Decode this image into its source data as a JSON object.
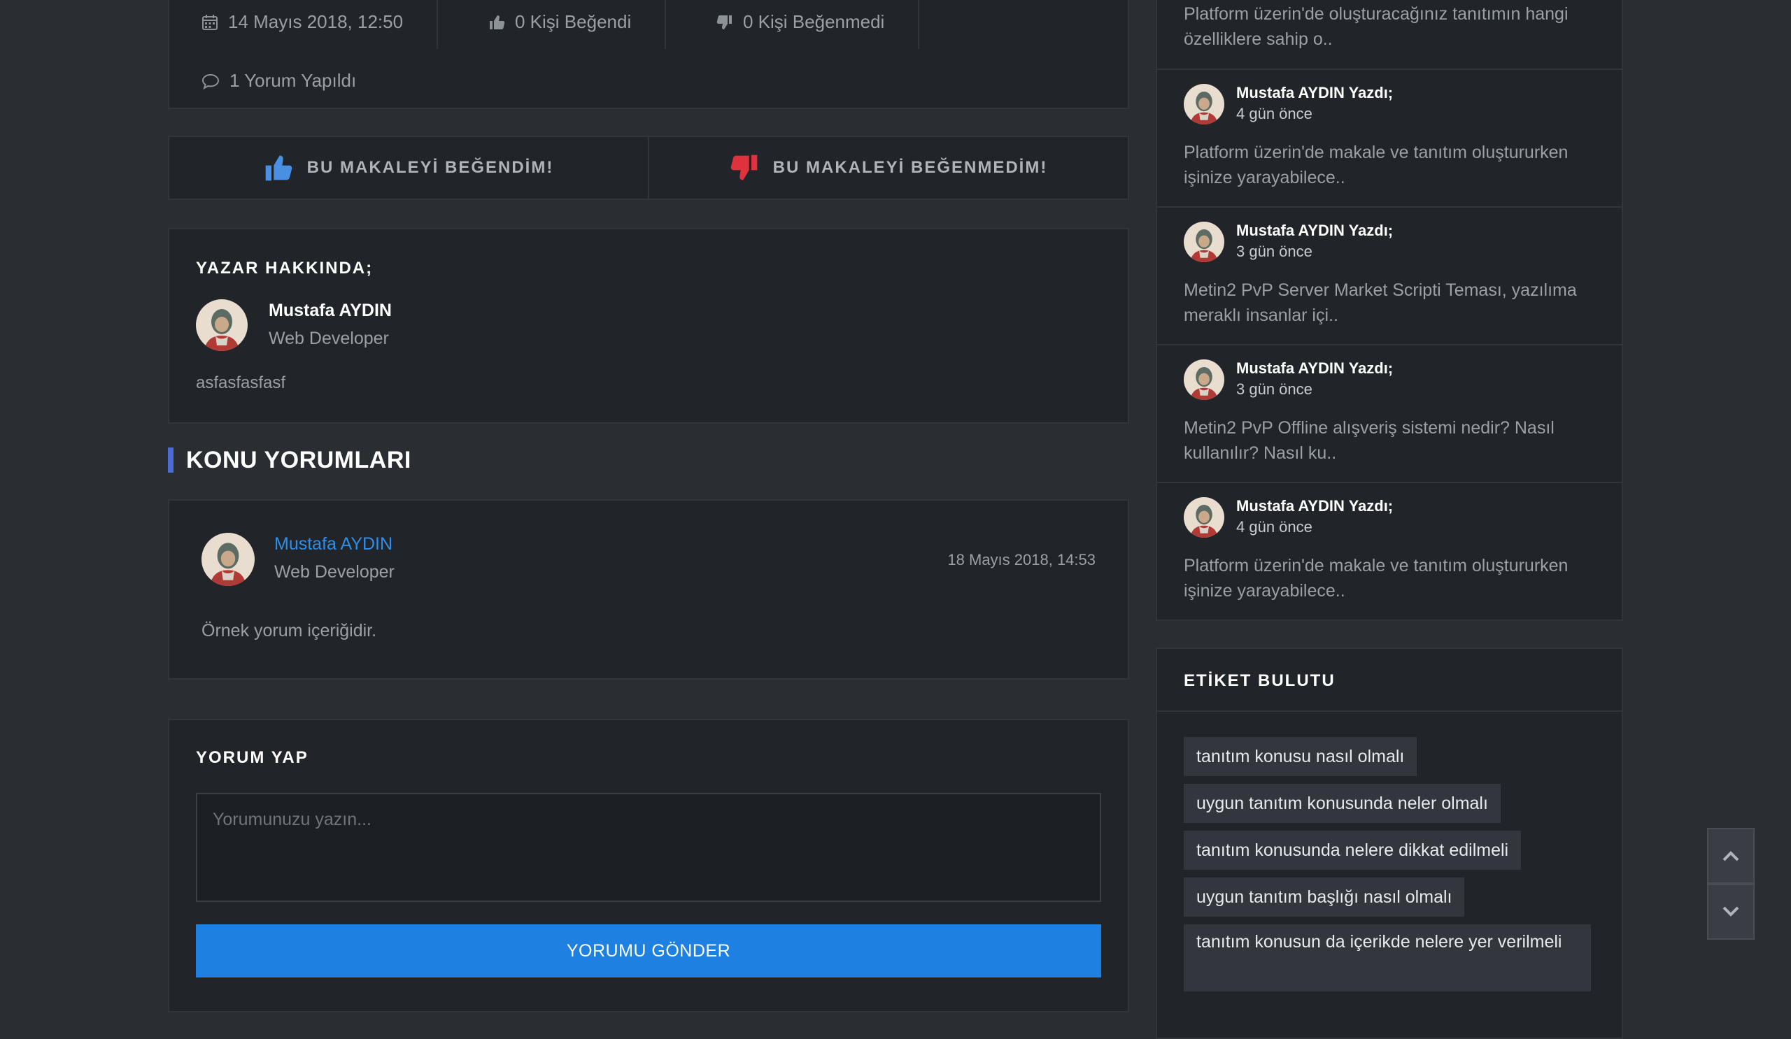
{
  "meta": {
    "date": "14 Mayıs 2018, 12:50",
    "likes": "0 Kişi Beğendi",
    "dislikes": "0 Kişi Beğenmedi",
    "comments": "1 Yorum Yapıldı"
  },
  "vote": {
    "like_label": "BU MAKALEYİ BEĞENDİM!",
    "dislike_label": "BU MAKALEYİ BEĞENMEDİM!"
  },
  "author": {
    "heading": "YAZAR HAKKINDA;",
    "name": "Mustafa AYDIN",
    "role": "Web Developer",
    "bio": "asfasfasfasf"
  },
  "comments_section": {
    "title": "KONU YORUMLARI",
    "items": [
      {
        "name": "Mustafa AYDIN",
        "role": "Web Developer",
        "date": "18 Mayıs 2018, 14:53",
        "text": "Örnek yorum içeriğidir."
      }
    ]
  },
  "form": {
    "heading": "YORUM YAP",
    "placeholder": "Yorumunuzu yazın...",
    "value": "",
    "submit_label": "YORUMU GÖNDER"
  },
  "sidebar": {
    "recent": [
      {
        "author": "",
        "time": "",
        "title": "Platform üzerin'de oluşturacağınız tanıtımın hangi özelliklere sahip o.."
      },
      {
        "author": "Mustafa AYDIN Yazdı;",
        "time": "4 gün önce",
        "title": "Platform üzerin'de makale ve tanıtım oluştururken işinize yarayabilece.."
      },
      {
        "author": "Mustafa AYDIN Yazdı;",
        "time": "3 gün önce",
        "title": "Metin2 PvP Server Market Scripti Teması, yazılıma meraklı insanlar içi.."
      },
      {
        "author": "Mustafa AYDIN Yazdı;",
        "time": "3 gün önce",
        "title": "Metin2 PvP Offline alışveriş sistemi nedir? Nasıl kullanılır? Nasıl ku.."
      },
      {
        "author": "Mustafa AYDIN Yazdı;",
        "time": "4 gün önce",
        "title": "Platform üzerin'de makale ve tanıtım oluştururken işinize yarayabilece.."
      }
    ],
    "tags_heading": "ETİKET BULUTU",
    "tags": [
      "tanıtım konusu nasıl olmalı",
      "uygun tanıtım konusunda neler olmalı",
      "tanıtım konusunda nelere dikkat edilmeli",
      "uygun tanıtım başlığı nasıl olmalı",
      "tanıtım konusun da içerikde nelere yer verilmeli"
    ]
  },
  "colors": {
    "background": "#2a2d31",
    "panel": "#212428",
    "accent_blue": "#1e80e0",
    "like_blue": "#4a90e2",
    "dislike_red": "#e0323c",
    "section_bar": "#4a6cd4"
  },
  "icons": {
    "date": "calendar-icon",
    "likes": "thumbs-up-icon",
    "dislikes": "thumbs-down-icon",
    "comments": "speech-bubble-icon",
    "scroll_up": "chevron-up-icon",
    "scroll_down": "chevron-down-icon"
  }
}
